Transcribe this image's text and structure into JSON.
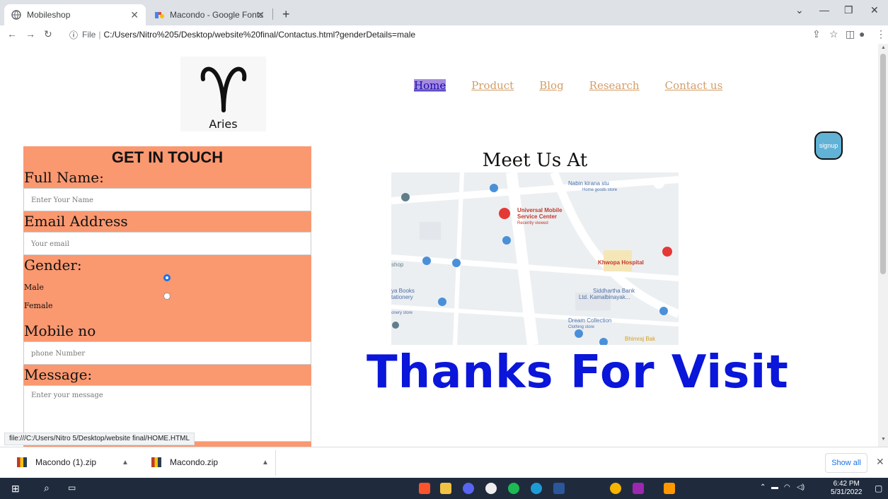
{
  "browser": {
    "tabs": [
      {
        "title": "Mobileshop",
        "active": true
      },
      {
        "title": "Macondo - Google Fonts",
        "active": false
      }
    ],
    "new_tab": "+",
    "address_prefix": "File",
    "url": "C:/Users/Nitro%205/Desktop/website%20final/Contactus.html?genderDetails=male",
    "status_url": "file:///C:/Users/Nitro 5/Desktop/website final/HOME.HTML"
  },
  "page": {
    "logo_text": "Aries",
    "nav": [
      "Home",
      "Product",
      "Blog",
      "Research",
      "Contact us"
    ],
    "signup_label": "signup",
    "form": {
      "title": "GET IN TOUCH",
      "full_name_label": "Full Name:",
      "full_name_placeholder": "Enter Your Name",
      "email_label": "Email Address",
      "email_placeholder": "Your email",
      "gender_label": "Gender:",
      "gender_options": [
        "Male",
        "Female"
      ],
      "gender_selected": "Male",
      "mobile_label": "Mobile no",
      "mobile_placeholder": "phone Number",
      "message_label": "Message:",
      "message_placeholder": "Enter your message"
    },
    "meet_title": "Meet Us At",
    "map_labels": {
      "store": "Nabin kirana stu",
      "store_type": "Home goods store",
      "service": "Universal Mobile",
      "service2": "Service Center",
      "recent": "Recently viewed",
      "hospital": "Khwopa Hospital",
      "shop": "shop",
      "books": "ya Books",
      "stationery": "tationery",
      "bank": "Siddhartha Bank",
      "bank2": "Ltd. Kamalbinayak...",
      "dream": "Dream Collection",
      "clothing": "Clothing store",
      "bhimraj": "Bhimraj Bak",
      "store_left": "onery store"
    },
    "thanks": "Thanks For Visit"
  },
  "downloads": {
    "items": [
      "Macondo (1).zip",
      "Macondo.zip"
    ],
    "show_all": "Show all"
  },
  "taskbar": {
    "time": "6:42 PM",
    "date": "5/31/2022"
  },
  "colors": {
    "form_bg": "#fa9870",
    "nav_link": "#d39d67",
    "thanks": "#0a16d9",
    "signup_bg": "#62b2d6"
  }
}
